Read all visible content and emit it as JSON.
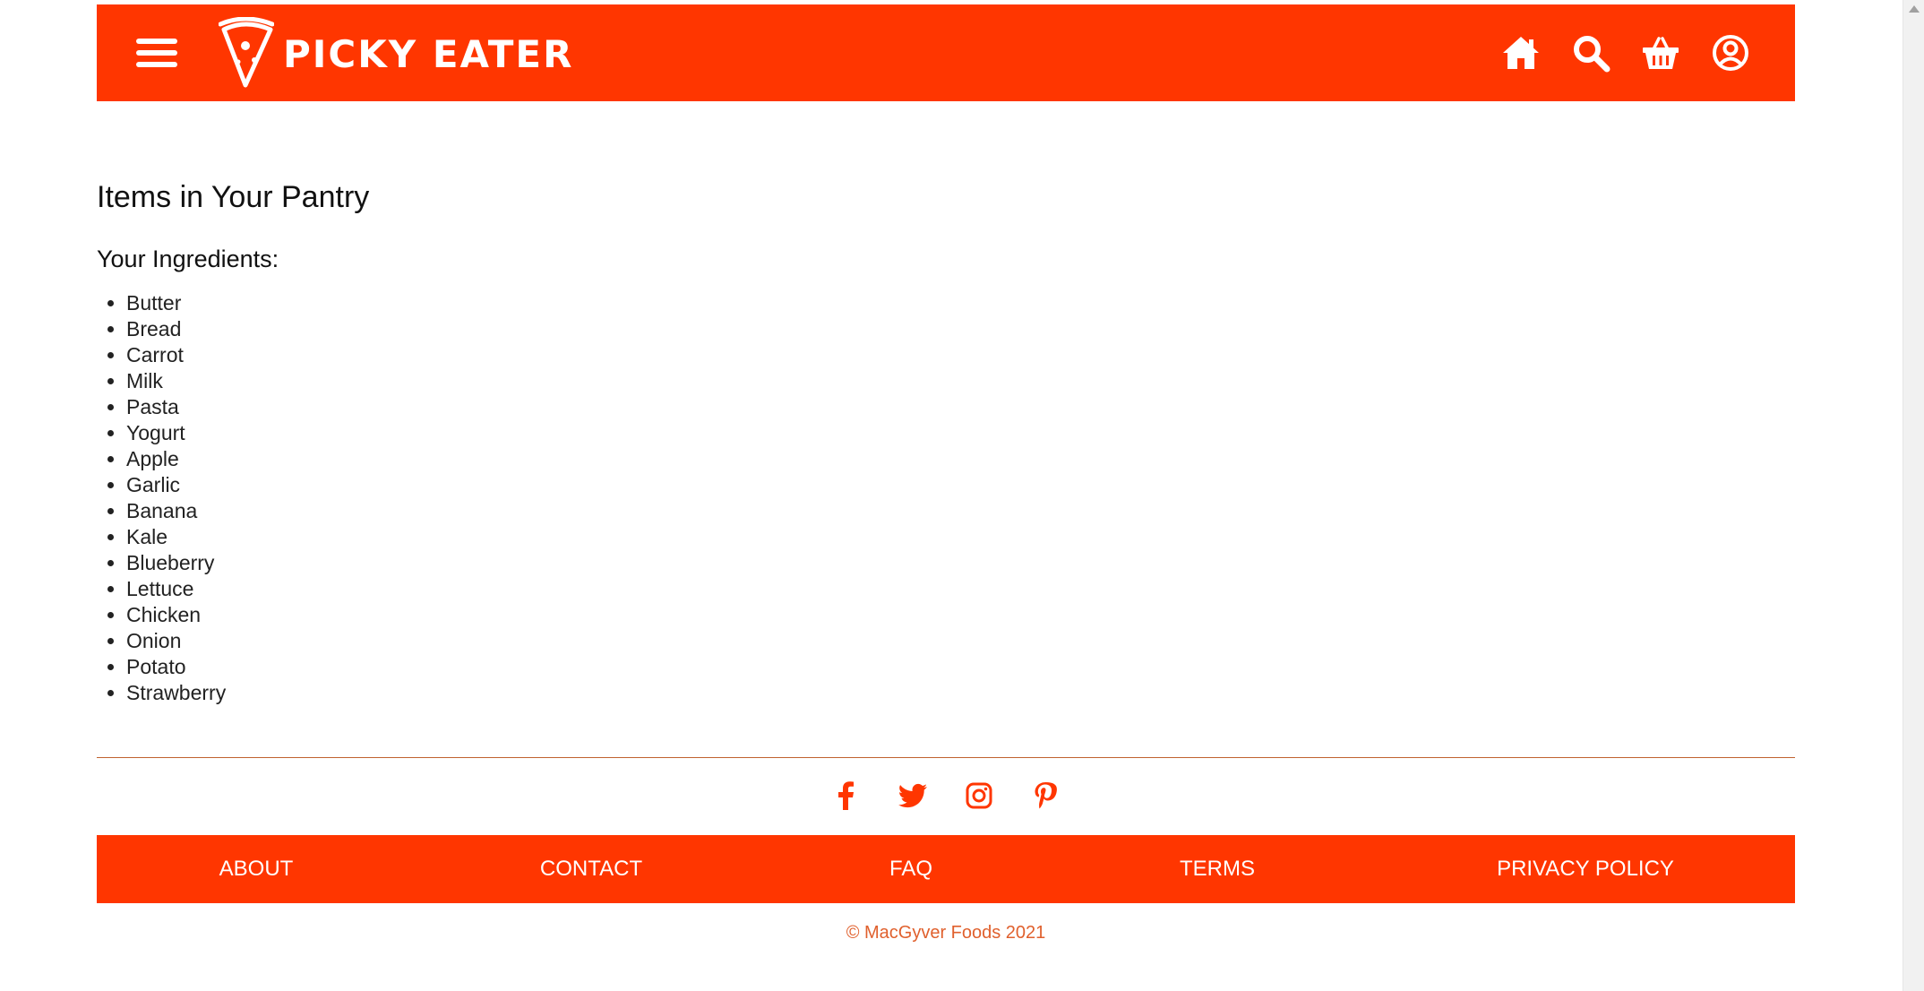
{
  "header": {
    "brand": "PICKY EATER",
    "background_color": "#ff3600",
    "icons": [
      "menu-icon",
      "home-icon",
      "search-icon",
      "basket-icon",
      "user-icon"
    ]
  },
  "main": {
    "title": "Items in Your Pantry",
    "subtitle": "Your Ingredients:",
    "ingredients": [
      "Butter",
      "Bread",
      "Carrot",
      "Milk",
      "Pasta",
      "Yogurt",
      "Apple",
      "Garlic",
      "Banana",
      "Kale",
      "Blueberry",
      "Lettuce",
      "Chicken",
      "Onion",
      "Potato",
      "Strawberry"
    ]
  },
  "social": {
    "icons": [
      "facebook-icon",
      "twitter-icon",
      "instagram-icon",
      "pinterest-icon"
    ],
    "color": "#ff3600"
  },
  "footer": {
    "links": [
      {
        "label": "ABOUT"
      },
      {
        "label": "CONTACT"
      },
      {
        "label": "FAQ"
      },
      {
        "label": "TERMS"
      },
      {
        "label": "PRIVACY POLICY"
      }
    ],
    "copyright": "© MacGyver Foods 2021"
  }
}
